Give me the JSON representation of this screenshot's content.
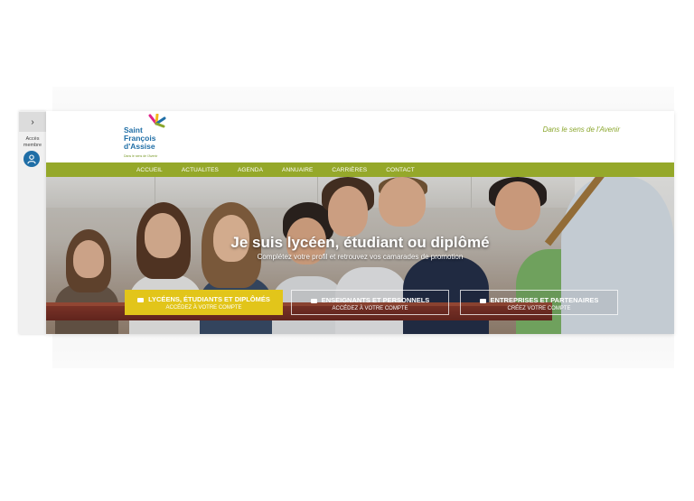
{
  "side_panel": {
    "toggle_icon": "chevron-right-icon",
    "label_line1": "Accès",
    "label_line2": "membre",
    "avatar_icon": "user-icon"
  },
  "header": {
    "logo_line1": "Saint",
    "logo_line2": "François",
    "logo_line3": "d'Assise",
    "logo_sub": "Dans le sens de l'Avenir",
    "tagline": "Dans le sens de l'Avenir"
  },
  "nav": {
    "items": [
      "ACCUEIL",
      "ACTUALITES",
      "AGENDA",
      "ANNUAIRE",
      "CARRIÈRES",
      "CONTACT"
    ]
  },
  "hero": {
    "title": "Je suis lycéen, étudiant ou diplômé",
    "subtitle": "Complétez votre profil et retrouvez vos camarades de promotion",
    "ctas": [
      {
        "title": "LYCÉENS, ÉTUDIANTS ET DIPLÔMÉS",
        "subtitle": "ACCÉDEZ À VOTRE COMPTE"
      },
      {
        "title": "ENSEIGNANTS ET PERSONNELS",
        "subtitle": "ACCÉDEZ À VOTRE COMPTE"
      },
      {
        "title": "ENTREPRISES ET PARTENAIRES",
        "subtitle": "CRÉEZ VOTRE COMPTE"
      }
    ]
  },
  "colors": {
    "nav_green": "#95a82a",
    "brand_blue": "#1f6ea6",
    "cta_yellow": "#e2c51a",
    "tagline_green": "#8aa62c"
  }
}
